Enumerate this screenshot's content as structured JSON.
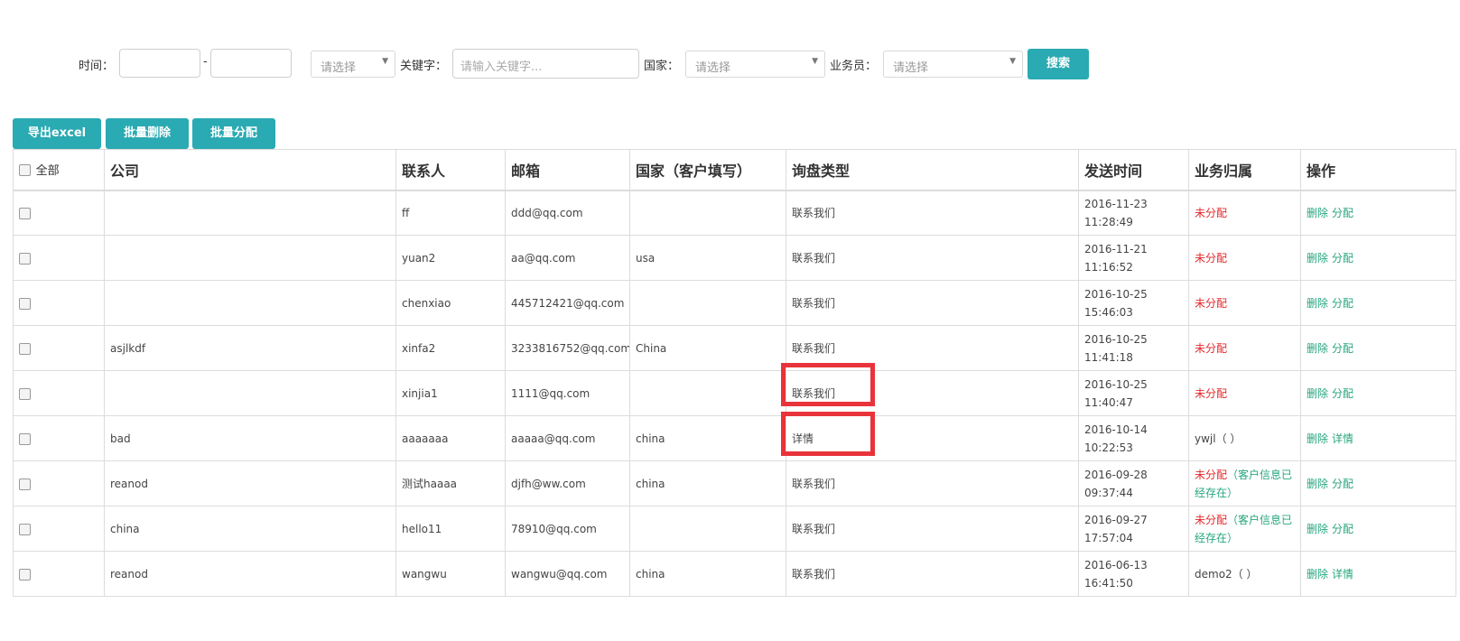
{
  "filters": {
    "time_label": "时间：",
    "date_from": "",
    "date_to": "",
    "dash": "-",
    "type_select": "请选择",
    "keyword_label": "关键字：",
    "keyword_placeholder": "请输入关键字...",
    "country_label": "国家：",
    "country_select": "请选择",
    "salesman_label": "业务员：",
    "salesman_select": "请选择",
    "search_label": "搜索"
  },
  "actions": {
    "export": "导出excel",
    "batch_delete": "批量删除",
    "batch_assign": "批量分配"
  },
  "table": {
    "headers": {
      "all": "全部",
      "company": "公司",
      "contact": "联系人",
      "email": "邮箱",
      "country": "国家（客户填写）",
      "type": "询盘类型",
      "time": "发送时间",
      "owner": "业务归属",
      "ops": "操作"
    },
    "rows": [
      {
        "company": "",
        "contact": "ff",
        "email": "ddd@qq.com",
        "country": "",
        "type": "联系我们",
        "date": "2016-11-23",
        "clock": "11:28:49",
        "owner": "未分配",
        "owner_note": "",
        "op1": "删除",
        "op2": "分配"
      },
      {
        "company": "",
        "contact": "yuan2",
        "email": "aa@qq.com",
        "country": "usa",
        "type": "联系我们",
        "date": "2016-11-21",
        "clock": "11:16:52",
        "owner": "未分配",
        "owner_note": "",
        "op1": "删除",
        "op2": "分配"
      },
      {
        "company": "",
        "contact": "chenxiao",
        "email": "445712421@qq.com",
        "country": "",
        "type": "联系我们",
        "date": "2016-10-25",
        "clock": "15:46:03",
        "owner": "未分配",
        "owner_note": "",
        "op1": "删除",
        "op2": "分配"
      },
      {
        "company": "asjlkdf",
        "contact": "xinfa2",
        "email": "3233816752@qq.com",
        "country": "China",
        "type": "联系我们",
        "date": "2016-10-25",
        "clock": "11:41:18",
        "owner": "未分配",
        "owner_note": "",
        "op1": "删除",
        "op2": "分配"
      },
      {
        "company": "",
        "contact": "xinjia1",
        "email": "1111@qq.com",
        "country": "",
        "type": "联系我们",
        "date": "2016-10-25",
        "clock": "11:40:47",
        "owner": "未分配",
        "owner_note": "",
        "op1": "删除",
        "op2": "分配"
      },
      {
        "company": "bad",
        "contact": "aaaaaaa",
        "email": "aaaaa@qq.com",
        "country": "china",
        "type": "详情",
        "date": "2016-10-14",
        "clock": "10:22:53",
        "owner": "ywjl（ ）",
        "owner_note": "",
        "op1": "删除",
        "op2": "详情"
      },
      {
        "company": "reanod",
        "contact": "测试haaaa",
        "email": "djfh@ww.com",
        "country": "china",
        "type": "联系我们",
        "date": "2016-09-28",
        "clock": "09:37:44",
        "owner": "未分配",
        "owner_note": "（客户信息已经存在）",
        "op1": "删除",
        "op2": "分配"
      },
      {
        "company": "china",
        "contact": "hello11",
        "email": "78910@qq.com",
        "country": "",
        "type": "联系我们",
        "date": "2016-09-27",
        "clock": "17:57:04",
        "owner": "未分配",
        "owner_note": "（客户信息已经存在）",
        "op1": "删除",
        "op2": "分配"
      },
      {
        "company": "reanod",
        "contact": "wangwu",
        "email": "wangwu@qq.com",
        "country": "china",
        "type": "联系我们",
        "date": "2016-06-13",
        "clock": "16:41:50",
        "owner": "demo2（ ）",
        "owner_note": "",
        "op1": "删除",
        "op2": "详情"
      }
    ]
  },
  "colors": {
    "accent": "#2aaab2",
    "unassigned": "#e4282b",
    "link": "#27a67f",
    "highlight": "#e8333a"
  }
}
